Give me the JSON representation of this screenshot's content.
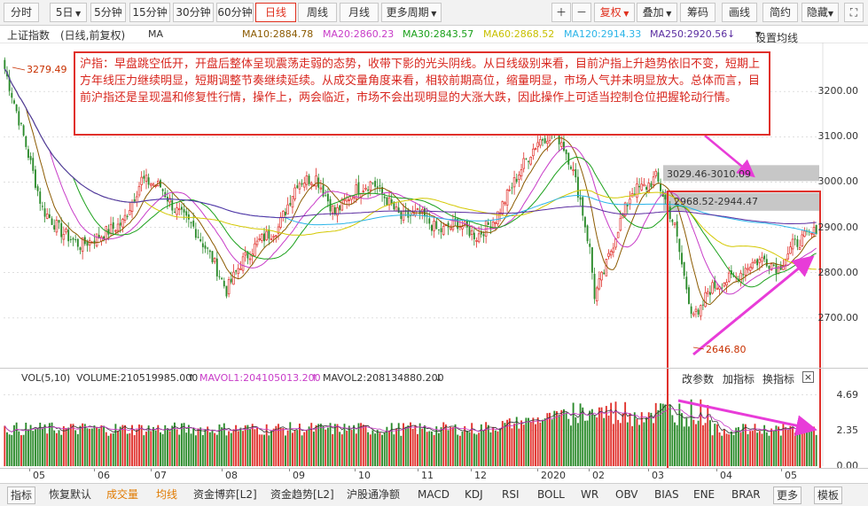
{
  "toolbar": {
    "left_items": [
      "分时",
      "5日",
      "5分钟",
      "15分钟",
      "30分钟",
      "60分钟",
      "日线",
      "周线",
      "月线",
      "更多周期"
    ],
    "active": "日线",
    "right_items": [
      "复权",
      "叠加",
      "筹码",
      "画线",
      "简约",
      "隐藏"
    ]
  },
  "info": {
    "index_name": "上证指数",
    "mode": "(日线,前复权)",
    "indicator": "MA",
    "ma10": "MA10:2884.78",
    "ma20": "MA20:2860.23",
    "ma30": "MA30:2843.57",
    "ma60": "MA60:2868.52",
    "ma120": "MA120:2914.33",
    "ma250": "MA250:2920.56",
    "settings": "设置均线"
  },
  "annotation": {
    "text": "沪指：早盘跳空低开，开盘后整体呈现震荡走弱的态势，收带下影的光头阴线。从日线级别来看，目前沪指上升趋势依旧不变，短期上方年线压力继续明显，短期调整节奏继续延续。从成交量角度来看，相较前期高位，缩量明显，市场人气并未明显放大。总体而言，目前沪指还是呈现温和修复性行情，操作上，两会临近，市场不会出现明显的大涨大跌，因此操作上可适当控制仓位把握轮动行情。"
  },
  "price_labels": {
    "high": "3279.49",
    "low": "2646.80",
    "zone1": "3029.46-3010.09",
    "zone2": "2968.52-2944.47"
  },
  "vol_info": {
    "title": "VOL(5,10)",
    "volume": "VOLUME:210519985.000",
    "mavol1": "MAVOL1:204105013.200",
    "mavol2": "MAVOL2:208134880.200"
  },
  "vol_buttons": [
    "改参数",
    "加指标",
    "换指标"
  ],
  "close_icon": "×",
  "bottom_items": [
    "指标",
    "恢复默认",
    "成交量",
    "均线",
    "资金博弈[L2]",
    "资金趋势[L2]",
    "沪股通净额",
    "MACD",
    "KDJ",
    "RSI",
    "BOLL",
    "WR",
    "OBV",
    "BIAS",
    "ENE",
    "BRAR",
    "更多",
    "模板"
  ],
  "colors": {
    "up": "#e0302b",
    "down": "#2a8a2a",
    "ma10": "#8b5a00",
    "ma20": "#c83cc8",
    "ma30": "#1aa01a",
    "ma60": "#d4c800",
    "ma120": "#2ab4e8",
    "ma250": "#5a2ca0",
    "arrow": "#e83cd8",
    "box": "#e0302b"
  },
  "chart_data": {
    "type": "candlestick",
    "title": "上证指数",
    "x_tick_labels": [
      "05",
      "06",
      "07",
      "08",
      "09",
      "10",
      "11",
      "12",
      "2020",
      "02",
      "03",
      "04",
      "05"
    ],
    "y_ticks": [
      2700,
      2800,
      2900,
      3000,
      3100,
      3200
    ],
    "ylim": [
      2600,
      3300
    ],
    "vol_ticks": [
      "0.00",
      "2.35",
      "4.69"
    ],
    "vol_ylim": [
      0,
      5.2
    ],
    "key_points": {
      "high": 3279.49,
      "low": 2646.8,
      "last_close": 2884.78
    },
    "resistance_zones": [
      [
        3010.09,
        3029.46
      ],
      [
        2944.47,
        2968.52
      ]
    ],
    "trend": [
      {
        "idx": 0,
        "v": 3250
      },
      {
        "idx": 8,
        "v": 3100
      },
      {
        "idx": 16,
        "v": 2940
      },
      {
        "idx": 24,
        "v": 2890
      },
      {
        "idx": 32,
        "v": 2860
      },
      {
        "idx": 40,
        "v": 2880
      },
      {
        "idx": 50,
        "v": 2910
      },
      {
        "idx": 58,
        "v": 3005
      },
      {
        "idx": 66,
        "v": 2990
      },
      {
        "idx": 72,
        "v": 2940
      },
      {
        "idx": 80,
        "v": 2900
      },
      {
        "idx": 88,
        "v": 2830
      },
      {
        "idx": 94,
        "v": 2760
      },
      {
        "idx": 100,
        "v": 2820
      },
      {
        "idx": 108,
        "v": 2870
      },
      {
        "idx": 116,
        "v": 2900
      },
      {
        "idx": 124,
        "v": 3000
      },
      {
        "idx": 132,
        "v": 3010
      },
      {
        "idx": 140,
        "v": 2930
      },
      {
        "idx": 148,
        "v": 2980
      },
      {
        "idx": 156,
        "v": 3000
      },
      {
        "idx": 162,
        "v": 2960
      },
      {
        "idx": 168,
        "v": 2920
      },
      {
        "idx": 176,
        "v": 2930
      },
      {
        "idx": 184,
        "v": 2890
      },
      {
        "idx": 192,
        "v": 2910
      },
      {
        "idx": 200,
        "v": 2880
      },
      {
        "idx": 208,
        "v": 2920
      },
      {
        "idx": 214,
        "v": 2980
      },
      {
        "idx": 220,
        "v": 3040
      },
      {
        "idx": 226,
        "v": 3090
      },
      {
        "idx": 232,
        "v": 3110
      },
      {
        "idx": 236,
        "v": 3090
      },
      {
        "idx": 240,
        "v": 3040
      },
      {
        "idx": 244,
        "v": 2960
      },
      {
        "idx": 248,
        "v": 2850
      },
      {
        "idx": 250,
        "v": 2750
      },
      {
        "idx": 254,
        "v": 2800
      },
      {
        "idx": 260,
        "v": 2900
      },
      {
        "idx": 266,
        "v": 2980
      },
      {
        "idx": 272,
        "v": 2990
      },
      {
        "idx": 276,
        "v": 3010
      },
      {
        "idx": 280,
        "v": 2960
      },
      {
        "idx": 284,
        "v": 2900
      },
      {
        "idx": 288,
        "v": 2790
      },
      {
        "idx": 291,
        "v": 2720
      },
      {
        "idx": 294,
        "v": 2700
      },
      {
        "idx": 298,
        "v": 2760
      },
      {
        "idx": 304,
        "v": 2780
      },
      {
        "idx": 310,
        "v": 2790
      },
      {
        "idx": 316,
        "v": 2820
      },
      {
        "idx": 322,
        "v": 2830
      },
      {
        "idx": 328,
        "v": 2810
      },
      {
        "idx": 334,
        "v": 2860
      },
      {
        "idx": 340,
        "v": 2880
      },
      {
        "idx": 344,
        "v": 2890
      }
    ]
  }
}
